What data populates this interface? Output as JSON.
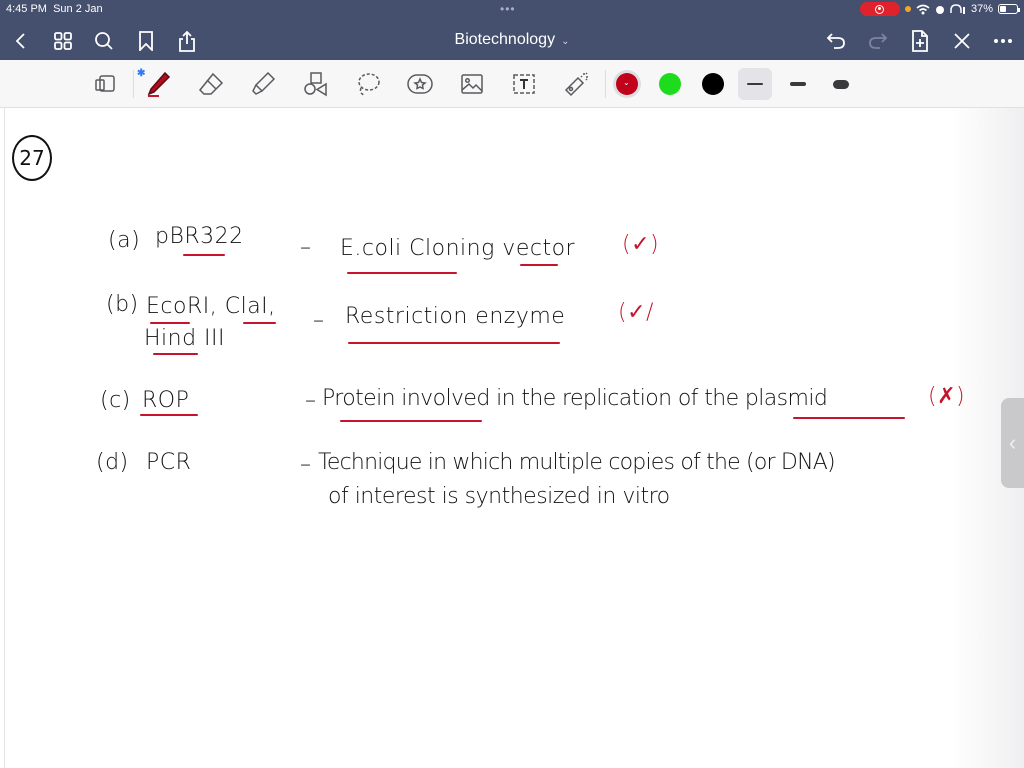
{
  "status_bar": {
    "time": "4:45 PM",
    "date": "Sun 2 Jan",
    "battery": "37%",
    "dots": "•••"
  },
  "nav": {
    "title": "Biotechnology",
    "title_chevron": "⌄"
  },
  "toolbar": {
    "tools": [
      "page-thumbnail",
      "pen",
      "eraser",
      "highlighter",
      "shapes",
      "lasso",
      "sticker",
      "image",
      "text-box",
      "laser-pointer"
    ],
    "colors": [
      {
        "name": "red",
        "hex": "#c0021a",
        "selected": true
      },
      {
        "name": "green",
        "hex": "#1edb1e",
        "selected": false
      },
      {
        "name": "black",
        "hex": "#000000",
        "selected": false
      }
    ],
    "stroke_widths": [
      "thin",
      "medium",
      "thick"
    ],
    "selected_stroke": "thin",
    "pen_color_caret": "⌄"
  },
  "note": {
    "question_number": "27",
    "items": [
      {
        "label": "(a)",
        "term": "pBR322",
        "dash": "–",
        "answer": "E.coli Cloning vector",
        "mark": "(✓)"
      },
      {
        "label": "(b)",
        "term": "EcoRI, ClaI,",
        "term_line2": "Hind III",
        "dash": "–",
        "answer": "Restriction enzyme",
        "mark": "(✓/"
      },
      {
        "label": "(c)",
        "term": "ROP",
        "dash": "–",
        "answer": "Protein involved in the replication of the plasmid",
        "mark": "(✗)"
      },
      {
        "label": "(d)",
        "term": "PCR",
        "dash": "–",
        "answer": "Technique in which multiple copies of the (or DNA)",
        "answer_line2": "of interest is synthesized in vitro",
        "mark": ""
      }
    ]
  },
  "side_panel": {
    "handle_glyph": "‹"
  },
  "colors": {
    "appbar": "#454f6e",
    "toolbar": "#f7f7f8",
    "ink_black": "#111111",
    "ink_red": "#c5142b"
  }
}
